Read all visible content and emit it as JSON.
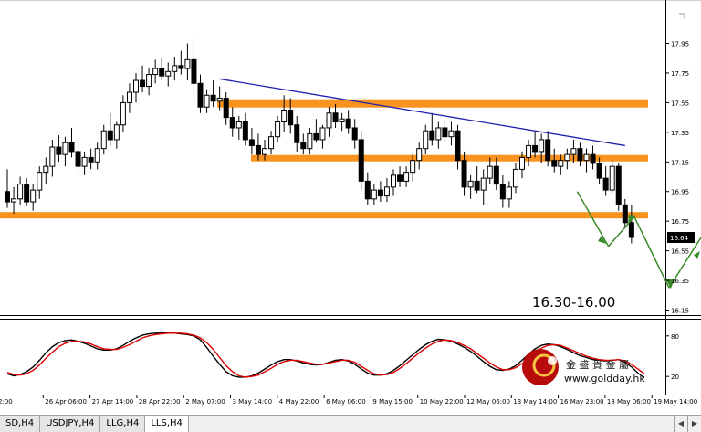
{
  "chart_data": [
    {
      "type": "candlestick",
      "symbol": "LLS,H4",
      "ylim": [
        16.1,
        18.0
      ],
      "y_ticks": [
        "17.95",
        "17.75",
        "17.55",
        "17.35",
        "17.15",
        "16.95",
        "16.75",
        "16.55",
        "16.35",
        "16.15"
      ],
      "x_ticks": [
        "2:00",
        "26 Apr 06:00",
        "27 Apr 14:00",
        "28 Apr 22:00",
        "2 May 07:00",
        "3 May 14:00",
        "4 May 22:00",
        "6 May 06:00",
        "9 May 15:00",
        "10 May 22:00",
        "12 May 06:00",
        "13 May 14:00",
        "16 May 23:00",
        "18 May 06:00",
        "19 May 14:00"
      ],
      "current_price": "16.64",
      "horizontal_levels": [
        {
          "name": "resistance-zone",
          "value": 17.545,
          "color": "#f7931e"
        },
        {
          "name": "support-level-upper",
          "value": 17.175,
          "color": "#f7931e"
        },
        {
          "name": "support-level-lower",
          "value": 16.79,
          "color": "#f7931e"
        }
      ],
      "trendline": {
        "color": "#1f1fb0",
        "from": {
          "bar": 33,
          "price": 17.71
        },
        "to": {
          "bar": 96,
          "price": 17.26
        }
      },
      "annotation": "16.30-16.00",
      "projection_color": "#3a8a2a",
      "candles": [
        {
          "o": 16.95,
          "h": 17.1,
          "l": 16.84,
          "c": 16.88
        },
        {
          "o": 16.88,
          "h": 16.98,
          "l": 16.8,
          "c": 16.9
        },
        {
          "o": 16.9,
          "h": 17.05,
          "l": 16.86,
          "c": 17.0
        },
        {
          "o": 17.0,
          "h": 17.04,
          "l": 16.85,
          "c": 16.88
        },
        {
          "o": 16.88,
          "h": 17.0,
          "l": 16.82,
          "c": 16.96
        },
        {
          "o": 16.96,
          "h": 17.12,
          "l": 16.9,
          "c": 17.08
        },
        {
          "o": 17.08,
          "h": 17.18,
          "l": 17.0,
          "c": 17.12
        },
        {
          "o": 17.12,
          "h": 17.3,
          "l": 17.05,
          "c": 17.25
        },
        {
          "o": 17.25,
          "h": 17.33,
          "l": 17.15,
          "c": 17.2
        },
        {
          "o": 17.2,
          "h": 17.32,
          "l": 17.12,
          "c": 17.28
        },
        {
          "o": 17.28,
          "h": 17.38,
          "l": 17.18,
          "c": 17.22
        },
        {
          "o": 17.22,
          "h": 17.3,
          "l": 17.08,
          "c": 17.12
        },
        {
          "o": 17.12,
          "h": 17.22,
          "l": 17.06,
          "c": 17.18
        },
        {
          "o": 17.18,
          "h": 17.24,
          "l": 17.1,
          "c": 17.15
        },
        {
          "o": 17.15,
          "h": 17.28,
          "l": 17.1,
          "c": 17.24
        },
        {
          "o": 17.24,
          "h": 17.4,
          "l": 17.2,
          "c": 17.36
        },
        {
          "o": 17.36,
          "h": 17.48,
          "l": 17.26,
          "c": 17.3
        },
        {
          "o": 17.3,
          "h": 17.42,
          "l": 17.24,
          "c": 17.4
        },
        {
          "o": 17.4,
          "h": 17.6,
          "l": 17.35,
          "c": 17.55
        },
        {
          "o": 17.55,
          "h": 17.68,
          "l": 17.48,
          "c": 17.62
        },
        {
          "o": 17.62,
          "h": 17.75,
          "l": 17.55,
          "c": 17.7
        },
        {
          "o": 17.7,
          "h": 17.8,
          "l": 17.62,
          "c": 17.66
        },
        {
          "o": 17.66,
          "h": 17.78,
          "l": 17.6,
          "c": 17.74
        },
        {
          "o": 17.74,
          "h": 17.84,
          "l": 17.68,
          "c": 17.78
        },
        {
          "o": 17.78,
          "h": 17.85,
          "l": 17.7,
          "c": 17.73
        },
        {
          "o": 17.73,
          "h": 17.82,
          "l": 17.66,
          "c": 17.76
        },
        {
          "o": 17.76,
          "h": 17.86,
          "l": 17.7,
          "c": 17.8
        },
        {
          "o": 17.8,
          "h": 17.9,
          "l": 17.74,
          "c": 17.78
        },
        {
          "o": 17.78,
          "h": 17.95,
          "l": 17.7,
          "c": 17.84
        },
        {
          "o": 17.84,
          "h": 17.98,
          "l": 17.6,
          "c": 17.68
        },
        {
          "o": 17.68,
          "h": 17.74,
          "l": 17.48,
          "c": 17.52
        },
        {
          "o": 17.52,
          "h": 17.64,
          "l": 17.48,
          "c": 17.6
        },
        {
          "o": 17.6,
          "h": 17.7,
          "l": 17.52,
          "c": 17.56
        },
        {
          "o": 17.56,
          "h": 17.66,
          "l": 17.5,
          "c": 17.58
        },
        {
          "o": 17.58,
          "h": 17.62,
          "l": 17.4,
          "c": 17.45
        },
        {
          "o": 17.45,
          "h": 17.52,
          "l": 17.32,
          "c": 17.38
        },
        {
          "o": 17.38,
          "h": 17.46,
          "l": 17.3,
          "c": 17.42
        },
        {
          "o": 17.42,
          "h": 17.48,
          "l": 17.26,
          "c": 17.3
        },
        {
          "o": 17.3,
          "h": 17.38,
          "l": 17.2,
          "c": 17.26
        },
        {
          "o": 17.26,
          "h": 17.34,
          "l": 17.16,
          "c": 17.2
        },
        {
          "o": 17.2,
          "h": 17.3,
          "l": 17.16,
          "c": 17.24
        },
        {
          "o": 17.24,
          "h": 17.36,
          "l": 17.2,
          "c": 17.32
        },
        {
          "o": 17.32,
          "h": 17.46,
          "l": 17.28,
          "c": 17.42
        },
        {
          "o": 17.42,
          "h": 17.6,
          "l": 17.35,
          "c": 17.5
        },
        {
          "o": 17.5,
          "h": 17.58,
          "l": 17.34,
          "c": 17.4
        },
        {
          "o": 17.4,
          "h": 17.46,
          "l": 17.22,
          "c": 17.28
        },
        {
          "o": 17.28,
          "h": 17.34,
          "l": 17.2,
          "c": 17.24
        },
        {
          "o": 17.24,
          "h": 17.38,
          "l": 17.2,
          "c": 17.34
        },
        {
          "o": 17.34,
          "h": 17.44,
          "l": 17.28,
          "c": 17.3
        },
        {
          "o": 17.3,
          "h": 17.4,
          "l": 17.24,
          "c": 17.38
        },
        {
          "o": 17.38,
          "h": 17.52,
          "l": 17.32,
          "c": 17.48
        },
        {
          "o": 17.48,
          "h": 17.54,
          "l": 17.38,
          "c": 17.42
        },
        {
          "o": 17.42,
          "h": 17.48,
          "l": 17.36,
          "c": 17.44
        },
        {
          "o": 17.44,
          "h": 17.5,
          "l": 17.34,
          "c": 17.38
        },
        {
          "o": 17.38,
          "h": 17.44,
          "l": 17.24,
          "c": 17.3
        },
        {
          "o": 17.3,
          "h": 17.36,
          "l": 16.96,
          "c": 17.02
        },
        {
          "o": 17.02,
          "h": 17.08,
          "l": 16.86,
          "c": 16.9
        },
        {
          "o": 16.9,
          "h": 17.0,
          "l": 16.86,
          "c": 16.96
        },
        {
          "o": 16.96,
          "h": 17.02,
          "l": 16.88,
          "c": 16.92
        },
        {
          "o": 16.92,
          "h": 17.04,
          "l": 16.88,
          "c": 16.98
        },
        {
          "o": 16.98,
          "h": 17.1,
          "l": 16.92,
          "c": 17.06
        },
        {
          "o": 17.06,
          "h": 17.12,
          "l": 16.98,
          "c": 17.02
        },
        {
          "o": 17.02,
          "h": 17.12,
          "l": 16.98,
          "c": 17.08
        },
        {
          "o": 17.08,
          "h": 17.2,
          "l": 17.02,
          "c": 17.16
        },
        {
          "o": 17.16,
          "h": 17.28,
          "l": 17.1,
          "c": 17.24
        },
        {
          "o": 17.24,
          "h": 17.4,
          "l": 17.2,
          "c": 17.36
        },
        {
          "o": 17.36,
          "h": 17.48,
          "l": 17.26,
          "c": 17.3
        },
        {
          "o": 17.3,
          "h": 17.42,
          "l": 17.24,
          "c": 17.38
        },
        {
          "o": 17.38,
          "h": 17.44,
          "l": 17.28,
          "c": 17.32
        },
        {
          "o": 17.32,
          "h": 17.42,
          "l": 17.26,
          "c": 17.36
        },
        {
          "o": 17.36,
          "h": 17.4,
          "l": 17.1,
          "c": 17.16
        },
        {
          "o": 17.16,
          "h": 17.22,
          "l": 16.92,
          "c": 16.98
        },
        {
          "o": 16.98,
          "h": 17.06,
          "l": 16.9,
          "c": 17.02
        },
        {
          "o": 17.02,
          "h": 17.12,
          "l": 16.94,
          "c": 16.96
        },
        {
          "o": 16.96,
          "h": 17.1,
          "l": 16.86,
          "c": 17.04
        },
        {
          "o": 17.04,
          "h": 17.18,
          "l": 17.0,
          "c": 17.12
        },
        {
          "o": 17.12,
          "h": 17.18,
          "l": 16.96,
          "c": 17.0
        },
        {
          "o": 17.0,
          "h": 17.06,
          "l": 16.84,
          "c": 16.9
        },
        {
          "o": 16.9,
          "h": 17.02,
          "l": 16.84,
          "c": 16.98
        },
        {
          "o": 16.98,
          "h": 17.14,
          "l": 16.94,
          "c": 17.1
        },
        {
          "o": 17.1,
          "h": 17.22,
          "l": 17.04,
          "c": 17.18
        },
        {
          "o": 17.18,
          "h": 17.3,
          "l": 17.12,
          "c": 17.26
        },
        {
          "o": 17.26,
          "h": 17.36,
          "l": 17.18,
          "c": 17.22
        },
        {
          "o": 17.22,
          "h": 17.34,
          "l": 17.14,
          "c": 17.3
        },
        {
          "o": 17.3,
          "h": 17.36,
          "l": 17.12,
          "c": 17.16
        },
        {
          "o": 17.16,
          "h": 17.24,
          "l": 17.08,
          "c": 17.12
        },
        {
          "o": 17.12,
          "h": 17.2,
          "l": 17.06,
          "c": 17.16
        },
        {
          "o": 17.16,
          "h": 17.24,
          "l": 17.1,
          "c": 17.2
        },
        {
          "o": 17.2,
          "h": 17.3,
          "l": 17.14,
          "c": 17.24
        },
        {
          "o": 17.24,
          "h": 17.28,
          "l": 17.12,
          "c": 17.16
        },
        {
          "o": 17.16,
          "h": 17.24,
          "l": 17.08,
          "c": 17.2
        },
        {
          "o": 17.2,
          "h": 17.26,
          "l": 17.1,
          "c": 17.14
        },
        {
          "o": 17.14,
          "h": 17.18,
          "l": 17.0,
          "c": 17.04
        },
        {
          "o": 17.04,
          "h": 17.12,
          "l": 16.92,
          "c": 16.96
        },
        {
          "o": 16.96,
          "h": 17.16,
          "l": 16.94,
          "c": 17.12
        },
        {
          "o": 17.12,
          "h": 17.14,
          "l": 16.82,
          "c": 16.86
        },
        {
          "o": 16.86,
          "h": 16.9,
          "l": 16.7,
          "c": 16.74
        },
        {
          "o": 16.74,
          "h": 16.86,
          "l": 16.6,
          "c": 16.64
        }
      ],
      "indicator": {
        "type": "stochastic",
        "ylim": [
          0,
          100
        ],
        "y_ticks": [
          "80",
          "20"
        ],
        "main_color": "#000000",
        "signal_color": "#e00000",
        "main": [
          24,
          21,
          23,
          27,
          34,
          44,
          55,
          64,
          70,
          73,
          74,
          72,
          69,
          65,
          61,
          59,
          59,
          61,
          66,
          72,
          77,
          81,
          83,
          84,
          84,
          85,
          84,
          83,
          82,
          80,
          74,
          63,
          50,
          38,
          27,
          21,
          19,
          19,
          21,
          25,
          31,
          37,
          42,
          45,
          45,
          43,
          40,
          38,
          37,
          38,
          41,
          44,
          45,
          43,
          38,
          31,
          25,
          22,
          22,
          24,
          29,
          36,
          44,
          52,
          60,
          67,
          72,
          75,
          74,
          72,
          68,
          63,
          57,
          50,
          42,
          35,
          30,
          29,
          31,
          36,
          44,
          53,
          61,
          66,
          68,
          67,
          64,
          60,
          55,
          51,
          48,
          45,
          44,
          43,
          44,
          45,
          41,
          34,
          25,
          18
        ],
        "signal": [
          26,
          23,
          22,
          24,
          29,
          37,
          47,
          56,
          64,
          69,
          72,
          72,
          71,
          68,
          64,
          61,
          60,
          60,
          63,
          67,
          72,
          77,
          80,
          82,
          83,
          84,
          84,
          84,
          83,
          81,
          77,
          70,
          60,
          48,
          36,
          27,
          21,
          19,
          20,
          22,
          27,
          32,
          38,
          42,
          44,
          44,
          42,
          40,
          38,
          38,
          40,
          42,
          44,
          44,
          41,
          35,
          29,
          24,
          22,
          23,
          26,
          32,
          39,
          47,
          55,
          62,
          68,
          72,
          74,
          73,
          70,
          66,
          61,
          54,
          47,
          40,
          34,
          30,
          30,
          33,
          39,
          47,
          55,
          62,
          66,
          67,
          66,
          62,
          58,
          54,
          50,
          47,
          45,
          44,
          44,
          45,
          43,
          38,
          31,
          24
        ]
      }
    }
  ],
  "logo": {
    "name": "金 盛 貴 金 屬",
    "url": "www.goldday.hk"
  },
  "tabs": [
    {
      "label": "SD,H4"
    },
    {
      "label": "USDJPY,H4"
    },
    {
      "label": "LLG,H4"
    },
    {
      "label": "LLS,H4",
      "active": true
    }
  ]
}
